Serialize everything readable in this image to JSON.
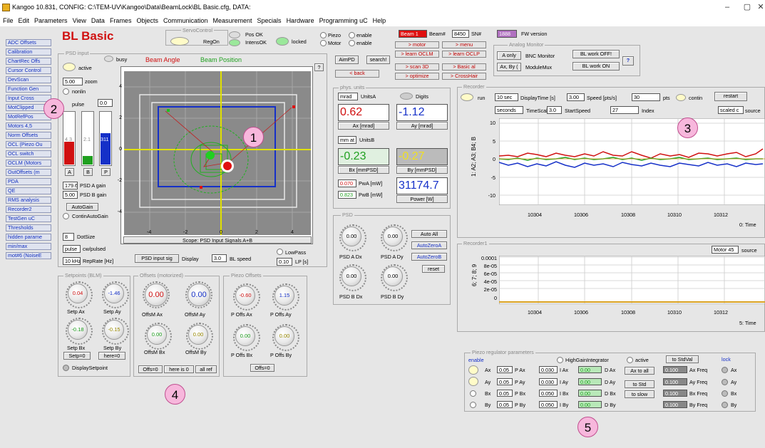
{
  "window": {
    "title": "Kangoo  10.831, CONFIG: C:\\TEM-UV\\Kangoo\\Data\\BeamLock\\BL Basic.cfg,  DATA:",
    "min": "–",
    "max": "▢",
    "close": "✕"
  },
  "menu": [
    "File",
    "Edit",
    "Parameters",
    "View",
    "Data",
    "Frames",
    "Objects",
    "Communication",
    "Measurement",
    "Specials",
    "Hardware",
    "Programming uC",
    "Help"
  ],
  "app_title": "BL Basic",
  "sidebar": [
    "ADC Offsets",
    "Calibration",
    "ChartRec Offs",
    "Cursor Control",
    "DevScan",
    "Function Gen",
    "Input Cross",
    "MotClipped",
    "MotRefPos",
    "Motors 4,5",
    "Norm Offsets",
    "OCL (Piezo Ou",
    "OCL switch",
    "OCLM (Motors",
    "OutOffsets (m",
    "PDA",
    "QE",
    "RMS analysis",
    "Recorder2",
    "TestGen uC",
    "Thresholds",
    "hidden parame",
    "min/max",
    "mot#6 (NoiseE"
  ],
  "servo": {
    "title": "ServoControl",
    "regon": "RegOn",
    "pos_ok": "Pos OK",
    "intens_ok": "IntensOK",
    "locked": "locked",
    "piezo": "Piezo",
    "motor": "Motor",
    "enable1": "enable",
    "enable2": "enable"
  },
  "beam": {
    "beam1": "Beam 1",
    "beam_no": "Beam#",
    "beam_val": "8450",
    "sn": "SN#",
    "sn_val": "1888",
    "fw": "FW version"
  },
  "psd_input": {
    "title": "PSD input",
    "busy": "busy",
    "active": "active",
    "zoom_val": "5.00",
    "zoom": "zoom",
    "nonlin": "nonlin",
    "pulse": "pulse",
    "pulse_val": "0.0",
    "bar_a": "4.3",
    "bar_b": "2.1",
    "bar_p": "311",
    "btn_a": "A",
    "btn_b": "B",
    "btn_p": "P",
    "gain_a_val": "179.6",
    "gain_a": "PSD A gain",
    "gain_b_val": "5.00",
    "gain_b": "PSD B gain",
    "autogain": "AutoGain",
    "contin": "ContinAutoGain",
    "dotsize_val": "8",
    "dotsize": "DotSize",
    "cw_val": "pulse",
    "cw": "cw/pulsed",
    "rep_val": "10 kHz",
    "rep": "RepRate [Hz]",
    "psd_sig": "PSD input sig",
    "display": "Display",
    "speed_val": "3.0",
    "speed": "BL speed",
    "lowpass": "LowPass",
    "lp_val": "0.10",
    "lp": "LP [s]"
  },
  "scope": {
    "beam_angle": "Beam Angle",
    "beam_position": "Beam Position",
    "help": "?",
    "caption": "Scope: PSD Input Signals A+B",
    "yticks": [
      "4",
      "2",
      "0",
      "-2",
      "-4"
    ],
    "xticks": [
      "-4",
      "-2",
      "0",
      "2",
      "4"
    ]
  },
  "nav": {
    "aimpd": "AimPD",
    "search": "search!",
    "motor": "> motor",
    "menu": "> menu",
    "learn_oclm": "> learn OCLM",
    "learn_oclp": "> learn OCLP",
    "back": "< back",
    "scan3d": "> scan 3D",
    "basic_al": "> Basic al",
    "optimize": "> optimize",
    "crosshair": "> CrossHair"
  },
  "analog": {
    "title": "Analog Monitor",
    "a_only": "A only",
    "bnc": "BNC Monitor",
    "ax_by": "Ax, By (",
    "module": "ModuleMux",
    "bl_off": "BL work OFF!",
    "bl_on": "BL work ON",
    "help": "?"
  },
  "phys": {
    "title": "phys. units",
    "units_a_val": "mrad",
    "units_a": "UnitsA",
    "digits": "Digits",
    "ax": "0.62",
    "ax_lbl": "Ax [mrad]",
    "ay": "-1.12",
    "ay_lbl": "Ay [mrad]",
    "units_b_val": "mm at f",
    "units_b": "UnitsB",
    "bx": "-0.23",
    "bx_lbl": "Bx [mmPSD]",
    "by": "-0.27",
    "by_lbl": "By [mmPSD]",
    "pwa_val": "0.070",
    "pwa": "PwA [mW]",
    "pwb_val": "0.823",
    "pwb": "PwB [mW]",
    "power": "31174.7",
    "power_lbl": "Power [W]"
  },
  "psd_panel": {
    "title": "PSD",
    "k1": "0.00",
    "k2": "0.00",
    "k3": "0.00",
    "k4": "0.00",
    "l1": "PSD A Dx",
    "l2": "PSD A Dy",
    "l3": "PSD B Dx",
    "l4": "PSD B Dy",
    "auto_all": "Auto All",
    "autozero_a": "AutoZeroA",
    "autozero_b": "AutoZeroB",
    "reset": "reset"
  },
  "recorder": {
    "title": "Recorder",
    "run": "run",
    "disp_val": "10 sec",
    "disp": "DisplayTime [s]",
    "speed_val": "3.00",
    "speed": "Speed [pts/s]",
    "pts_val": "30",
    "pts": "pts",
    "contin": "contin",
    "restart": "restart",
    "ts_val": "seconds",
    "ts": "TimeScale",
    "start_val": "3.0",
    "start": "StartSpeed",
    "idx_val": "27",
    "idx": "Index",
    "scaled": "scaled c",
    "source": "source",
    "ylabel": "1: A2; A3; B4; B",
    "yticks": [
      "10",
      "5",
      "0",
      "-5",
      "-10"
    ],
    "xticks": [
      "10304",
      "10306",
      "10308",
      "10310",
      "10312"
    ],
    "xlabel": "0: Time"
  },
  "recorder1": {
    "title": "Recorder1",
    "motor": "Motor 45",
    "source": "source",
    "ylabel": "6; 7; 8; 9",
    "yticks": [
      "0.0001",
      "8e-05",
      "6e-05",
      "4e-05",
      "2e-05",
      "0"
    ],
    "xticks": [
      "10304",
      "10306",
      "10308",
      "10310",
      "10312"
    ],
    "xlabel": "5: Time"
  },
  "setpoints": {
    "title": "Setpoints (BLM)",
    "ax": "0.04",
    "ay": "-1.46",
    "bx": "-0.18",
    "by": "-0.15",
    "ax_l": "Setp Ax",
    "ay_l": "Setp Ay",
    "bx_l": "Setp Bx",
    "by_l": "Setp By",
    "setp0": "Setp=0",
    "here0": "here=0",
    "display": "DisplaySetpoint"
  },
  "offsets": {
    "title": "Offsets (motorized)",
    "ax": "0.00",
    "ay": "0.00",
    "bx": "0.00",
    "by": "0.00",
    "ax_l": "OffsM Ax",
    "ay_l": "OffsM Ay",
    "bx_l": "OffsM Bx",
    "by_l": "OffsM By",
    "offs0": "Offs=0",
    "herei": "here is 0",
    "allref": "all ref"
  },
  "piezo_offs": {
    "title": "Piezo Offsets",
    "ax": "-0.60",
    "ay": "1.15",
    "bx": "0.00",
    "by": "0.00",
    "ax_l": "P Offs Ax",
    "ay_l": "P Offs Ay",
    "bx_l": "P Offs Bx",
    "by_l": "P Offs By",
    "offs0": "Offs=0"
  },
  "piezo_reg": {
    "title": "Piezo regulator parameters",
    "enable": "enable",
    "hgi": "HighGainIntegrator",
    "active": "active",
    "to_stdval": "to StdVal",
    "lock": "lock",
    "rows": [
      {
        "name": "Ax",
        "p": "0.05",
        "pl": "P Ax",
        "i": "0.030",
        "il": "I Ax",
        "d": "0.00",
        "dl": "D Ax",
        "f": "0.100",
        "fl": "Ax Freq",
        "lk": "Ax"
      },
      {
        "name": "Ay",
        "p": "0.05",
        "pl": "P Ay",
        "i": "0.030",
        "il": "I Ay",
        "d": "0.00",
        "dl": "D Ay",
        "f": "0.100",
        "fl": "Ay Freq",
        "lk": "Ay"
      },
      {
        "name": "Bx",
        "p": "0.05",
        "pl": "P Bx",
        "i": "0.050",
        "il": "I Bx",
        "d": "0.00",
        "dl": "D Bx",
        "f": "0.100",
        "fl": "Bx Freq",
        "lk": "Bx"
      },
      {
        "name": "By",
        "p": "0.05",
        "pl": "P By",
        "i": "0.050",
        "il": "I By",
        "d": "0.00",
        "dl": "D By",
        "f": "0.100",
        "fl": "By Freq",
        "lk": "By"
      }
    ],
    "ax_to_all": "Ax to all",
    "to_std": "to Std",
    "to_slow": "to slow"
  },
  "callouts": [
    "1",
    "2",
    "3",
    "4",
    "5"
  ],
  "colors": {
    "red": "#d01010",
    "blue": "#1530c8",
    "green": "#20a020",
    "sidebar_text": "#1330c0"
  }
}
